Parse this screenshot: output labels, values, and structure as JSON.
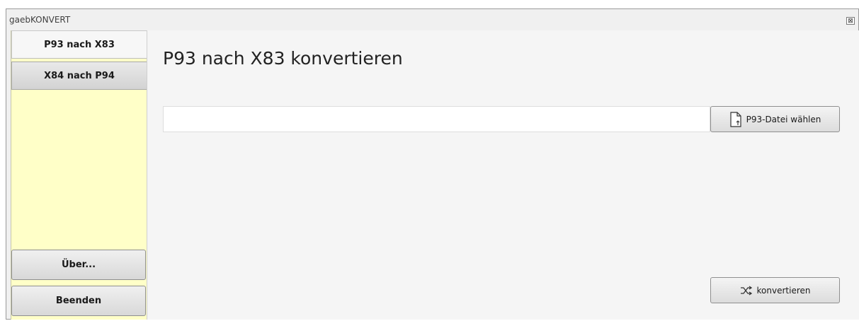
{
  "window": {
    "title": "gaebKONVERT",
    "close_glyph": "⊠"
  },
  "sidebar": {
    "tabs": [
      {
        "label": "P93 nach X83",
        "active": true
      },
      {
        "label": "X84 nach P94",
        "active": false
      }
    ],
    "buttons": [
      {
        "label": "Über..."
      },
      {
        "label": "Beenden"
      }
    ],
    "background_color": "#ffffc8"
  },
  "main": {
    "title": "P93 nach X83 konvertieren",
    "file_input": {
      "value": "",
      "placeholder": ""
    },
    "choose_button": {
      "label": "P93-Datei wählen",
      "icon": "document-icon"
    },
    "convert_button": {
      "label": "konvertieren",
      "icon": "shuffle-icon"
    }
  }
}
